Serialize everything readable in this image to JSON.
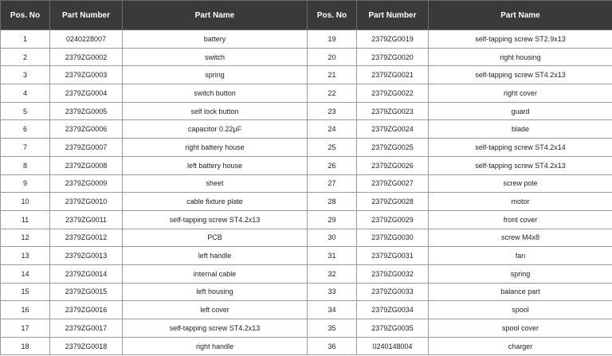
{
  "headers": [
    "Pos. No",
    "Part Number",
    "Part Name",
    "Pos. No",
    "Part Number",
    "Part Name"
  ],
  "rows": [
    [
      "1",
      "0240228007",
      "battery",
      "19",
      "2379ZG0019",
      "self-tapping screw ST2.9x13"
    ],
    [
      "2",
      "2379ZG0002",
      "switch",
      "20",
      "2379ZG0020",
      "right housing"
    ],
    [
      "3",
      "2379ZG0003",
      "spring",
      "21",
      "2379ZG0021",
      "self-tapping screw ST4.2x13"
    ],
    [
      "4",
      "2379ZG0004",
      "switch button",
      "22",
      "2379ZG0022",
      "right cover"
    ],
    [
      "5",
      "2379ZG0005",
      "self lock button",
      "23",
      "2379ZG0023",
      "guard"
    ],
    [
      "6",
      "2379ZG0006",
      "capacitor 0.22μF",
      "24",
      "2379ZG0024",
      "blade"
    ],
    [
      "7",
      "2379ZG0007",
      "right battery house",
      "25",
      "2379ZG0025",
      "self-tapping screw ST4.2x14"
    ],
    [
      "8",
      "2379ZG0008",
      "left battery house",
      "26",
      "2379ZG0026",
      "self-tapping screw ST4.2x13"
    ],
    [
      "9",
      "2379ZG0009",
      "sheet",
      "27",
      "2379ZG0027",
      "screw pole"
    ],
    [
      "10",
      "2379ZG0010",
      "cable fixture plate",
      "28",
      "2379ZG0028",
      "motor"
    ],
    [
      "11",
      "2379ZG0011",
      "self-tapping screw ST4.2x13",
      "29",
      "2379ZG0029",
      "front cover"
    ],
    [
      "12",
      "2379ZG0012",
      "PCB",
      "30",
      "2379ZG0030",
      "screw M4x8"
    ],
    [
      "13",
      "2379ZG0013",
      "left handle",
      "31",
      "2379ZG0031",
      "fan"
    ],
    [
      "14",
      "2379ZG0014",
      "internal cable",
      "32",
      "2379ZG0032",
      "spring"
    ],
    [
      "15",
      "2379ZG0015",
      "left housing",
      "33",
      "2379ZG0033",
      "balance part"
    ],
    [
      "16",
      "2379ZG0016",
      "left cover",
      "34",
      "2379ZG0034",
      "spool"
    ],
    [
      "17",
      "2379ZG0017",
      "self-tapping screw ST4.2x13",
      "35",
      "2379ZG0035",
      "spool cover"
    ],
    [
      "18",
      "2379ZG0018",
      "right handle",
      "36",
      "0240148004",
      "charger"
    ]
  ]
}
